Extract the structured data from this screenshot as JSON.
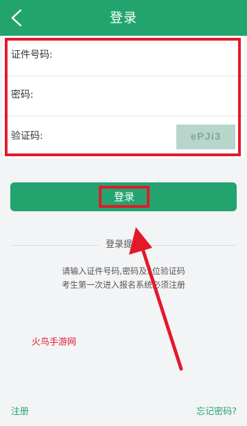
{
  "header": {
    "title": "登录",
    "back_icon": "chevron-left-icon",
    "color": "#23a46f"
  },
  "form": {
    "id_label": "证件号码:",
    "password_label": "密码:",
    "captcha_label": "验证码:",
    "captcha_text": "ePJi3"
  },
  "login_button": {
    "label": "登录"
  },
  "tips": {
    "title": "登录提示",
    "line1": "请输入证件号码,密码及5位验证码",
    "line2": "考生第一次进入报名系统必须注册"
  },
  "watermark": "火鸟手游网",
  "footer": {
    "register_link": "注册",
    "forgot_link": "忘记密码?"
  },
  "annotation_color": "#e3192a"
}
